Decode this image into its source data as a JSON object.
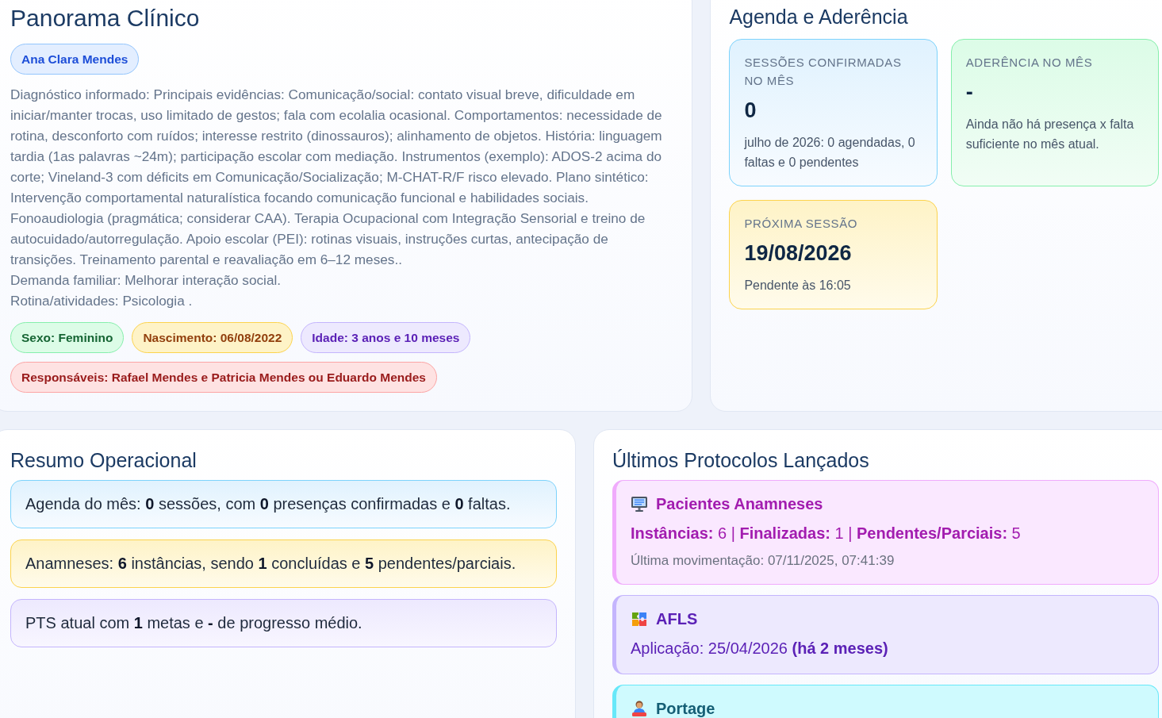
{
  "clinical_overview": {
    "title": "Panorama Clínico",
    "patient_name": "Ana Clara Mendes",
    "diagnosis": "Diagnóstico informado: Principais evidências: Comunicação/social: contato visual breve, dificuldade em iniciar/manter trocas, uso limitado de gestos; fala com ecolalia ocasional. Comportamentos: necessidade de rotina, desconforto com ruídos; interesse restrito (dinossauros); alinhamento de objetos. História: linguagem tardia (1as palavras ~24m); participação escolar com mediação. Instrumentos (exemplo): ADOS-2 acima do corte; Vineland-3 com déficits em Comunicação/Socialização; M-CHAT-R/F risco elevado. Plano sintético: Intervenção comportamental naturalística focando comunicação funcional e habilidades sociais. Fonoaudiologia (pragmática; considerar CAA). Terapia Ocupacional com Integração Sensorial e treino de autocuidado/autorregulação. Apoio escolar (PEI): rotinas visuais, instruções curtas, antecipação de transições. Treinamento parental e reavaliação em 6–12 meses..",
    "family_demand": "Demanda familiar: Melhorar interação social.",
    "routine": "Rotina/atividades: Psicologia .",
    "tags": [
      {
        "text": "Sexo: Feminino",
        "color": "#86efac"
      },
      {
        "text": "Nascimento: 06/08/2022",
        "color": "#fcd34d"
      },
      {
        "text": "Idade: 3 anos e 10 meses",
        "color": "#c4b5fd"
      },
      {
        "text": "Responsáveis: Rafael Mendes e Patricia Mendes ou Eduardo Mendes",
        "color": "#fca5a5"
      }
    ]
  },
  "schedule_adherence": {
    "title": "Agenda e Aderência",
    "cards": [
      {
        "label": "SESSÕES CONFIRMADAS NO MÊS",
        "value": "0",
        "detail": "julho de 2026: 0 agendadas, 0 faltas e 0 pendentes",
        "color": "#7dd3fc"
      },
      {
        "label": "ADERÊNCIA NO MÊS",
        "value": "-",
        "detail": "Ainda não há presença x falta suficiente no mês atual.",
        "color": "#86efac"
      },
      {
        "label": "PRÓXIMA SESSÃO",
        "value": "19/08/2026",
        "detail": "Pendente às 16:05",
        "color": "#fcd34d"
      }
    ]
  },
  "operational_summary": {
    "title": "Resumo Operacional",
    "items": [
      {
        "text": "Agenda do mês: **0** sessões, com **0** presenças confirmadas e **0** faltas.",
        "color": "#7dd3fc"
      },
      {
        "text": "Anamneses: **6** instâncias, sendo **1** concluídas e **5** pendentes/parciais.",
        "color": "#fcd34d"
      },
      {
        "text": "PTS atual com **1** metas e **-** de progresso médio.",
        "color": "#c4b5fd"
      }
    ]
  },
  "latest_protocols": {
    "title": "Últimos Protocolos Lançados",
    "protocols": [
      {
        "title": "Pacientes Anamneses",
        "color": "#f0abfc",
        "lines": [
          {
            "kind": "stats",
            "text": "**Instâncias:** 6 | **Finalizadas:** 1 | **Pendentes/Parciais:** 5"
          },
          {
            "kind": "meta",
            "text": "Última movimentação: 07/11/2025, 07:41:39"
          }
        ]
      },
      {
        "title": "AFLS",
        "color": "#c4b5fd",
        "lines": [
          {
            "kind": "stats",
            "text": "Aplicação: 25/04/2026 **(há 2 meses)**"
          }
        ]
      },
      {
        "title": "Portage",
        "color": "#67e8f9"
      }
    ]
  }
}
